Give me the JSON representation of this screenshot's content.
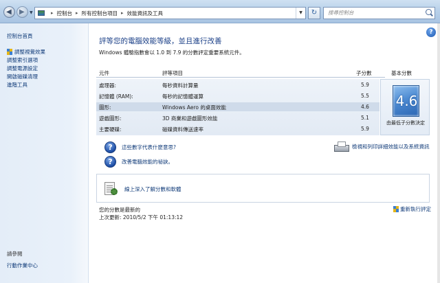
{
  "address": {
    "crumbs": [
      "控制台",
      "所有控制台項目",
      "效能資訊及工具"
    ],
    "search_placeholder": "搜尋控制台"
  },
  "sidebar": {
    "home": "控制台首頁",
    "links": [
      "調整視覺效果",
      "調整索引選項",
      "調整電源設定",
      "開啟磁碟清理",
      "進階工具"
    ],
    "see_also_title": "請參閱",
    "action_center": "行動作業中心"
  },
  "main": {
    "heading": "評等您的電腦效能等級，並且進行改善",
    "description": "Windows 體驗指數會以 1.0 到 7.9 的分數評定重要系統元件。",
    "columns": {
      "component": "元件",
      "rated": "評等項目",
      "subscore": "子分數",
      "basescore": "基本分數"
    },
    "rows": [
      {
        "component": "處理器:",
        "rated": "每秒資料計算量",
        "subscore": "5.9"
      },
      {
        "component": "記憶體 (RAM):",
        "rated": "每秒的記憶體運算",
        "subscore": "5.5"
      },
      {
        "component": "圖形:",
        "rated": "Windows Aero 的桌面效能",
        "subscore": "4.6"
      },
      {
        "component": "遊戲圖形:",
        "rated": "3D 商業和遊戲圖形效能",
        "subscore": "5.1"
      },
      {
        "component": "主要硬碟:",
        "rated": "磁碟資料傳送速率",
        "subscore": "5.9"
      }
    ],
    "base_score": "4.6",
    "base_note": "由最低子分數決定",
    "link_meaning": "這些數字代表什麼意思?",
    "link_improve": "改善電腦效能的祕訣。",
    "link_print": "檢視和列印詳細效能以及系統資訊",
    "link_online": "線上深入了解分數和軟體",
    "status_current": "您的分數是最新的",
    "status_updated": "上次更新: 2010/5/2 下午 01:13:12",
    "rerun": "重新執行評定"
  },
  "colors": {
    "heading": "#1a3f87",
    "link": "#0f3a78",
    "badge": "#2b66b3"
  },
  "icons": {
    "back": "back-arrow-icon",
    "forward": "forward-arrow-icon",
    "refresh": "refresh-icon",
    "search": "search-icon",
    "help": "help-icon",
    "shield": "uac-shield-icon",
    "question": "question-icon",
    "printer": "printer-icon",
    "tools": "tools-icon"
  }
}
